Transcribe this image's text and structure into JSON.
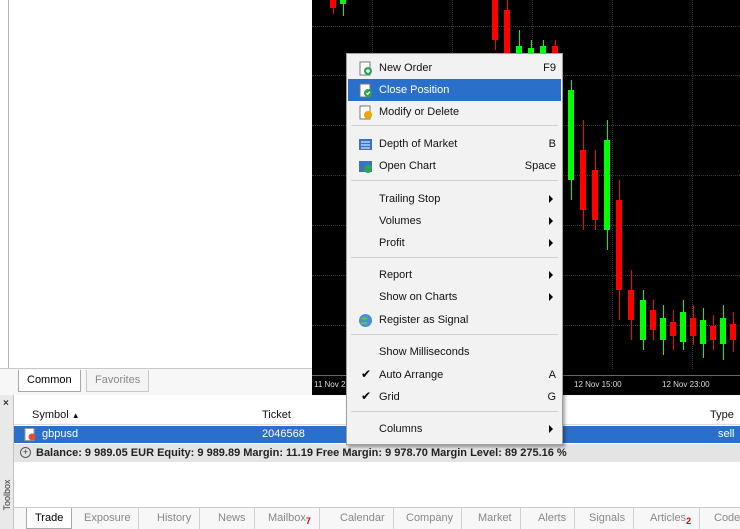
{
  "navigator": {
    "tabs": [
      "Common",
      "Favorites"
    ]
  },
  "chart": {
    "time_labels": [
      "11 Nov 2",
      "12 Nov 15:00",
      "12 Nov 23:00"
    ],
    "colors": {
      "bull": "#00ff00",
      "bear": "#ff0000",
      "background": "#000000"
    }
  },
  "context_menu": {
    "items": [
      {
        "label": "New Order",
        "shortcut": "F9",
        "icon": "new-order-icon"
      },
      {
        "label": "Close Position",
        "shortcut": "",
        "icon": "close-position-icon",
        "selected": true
      },
      {
        "label": "Modify or Delete",
        "shortcut": "",
        "icon": "modify-icon"
      },
      {
        "label": "Depth of Market",
        "shortcut": "B",
        "icon": "depth-of-market-icon"
      },
      {
        "label": "Open Chart",
        "shortcut": "Space",
        "icon": "open-chart-icon"
      },
      {
        "label": "Trailing Stop",
        "submenu": true
      },
      {
        "label": "Volumes",
        "submenu": true
      },
      {
        "label": "Profit",
        "submenu": true
      },
      {
        "label": "Report",
        "submenu": true
      },
      {
        "label": "Show on Charts",
        "submenu": true
      },
      {
        "label": "Register as Signal",
        "icon": "signal-globe-icon"
      },
      {
        "label": "Show Milliseconds"
      },
      {
        "label": "Auto Arrange",
        "shortcut": "A",
        "checked": true
      },
      {
        "label": "Grid",
        "shortcut": "G",
        "checked": true
      },
      {
        "label": "Columns",
        "submenu": true
      }
    ]
  },
  "toolbox": {
    "label": "Toolbox",
    "close": "×",
    "columns": {
      "symbol": "Symbol",
      "ticket": "Ticket",
      "type": "Type"
    },
    "sort_indicator": "▲",
    "rows": [
      {
        "symbol": "gbpusd",
        "ticket": "2046568",
        "type": "sell"
      }
    ],
    "balance_text": "Balance: 9 989.05 EUR  Equity: 9 989.89  Margin: 11.19  Free Margin: 9 978.70  Margin Level: 89 275.16 %",
    "tabs": [
      {
        "label": "Trade",
        "active": true
      },
      {
        "label": "Exposure"
      },
      {
        "label": "History"
      },
      {
        "label": "News"
      },
      {
        "label": "Mailbox",
        "badge": "7"
      },
      {
        "label": "Calendar"
      },
      {
        "label": "Company"
      },
      {
        "label": "Market"
      },
      {
        "label": "Alerts"
      },
      {
        "label": "Signals"
      },
      {
        "label": "Articles",
        "badge": "2"
      },
      {
        "label": "Code"
      }
    ]
  }
}
